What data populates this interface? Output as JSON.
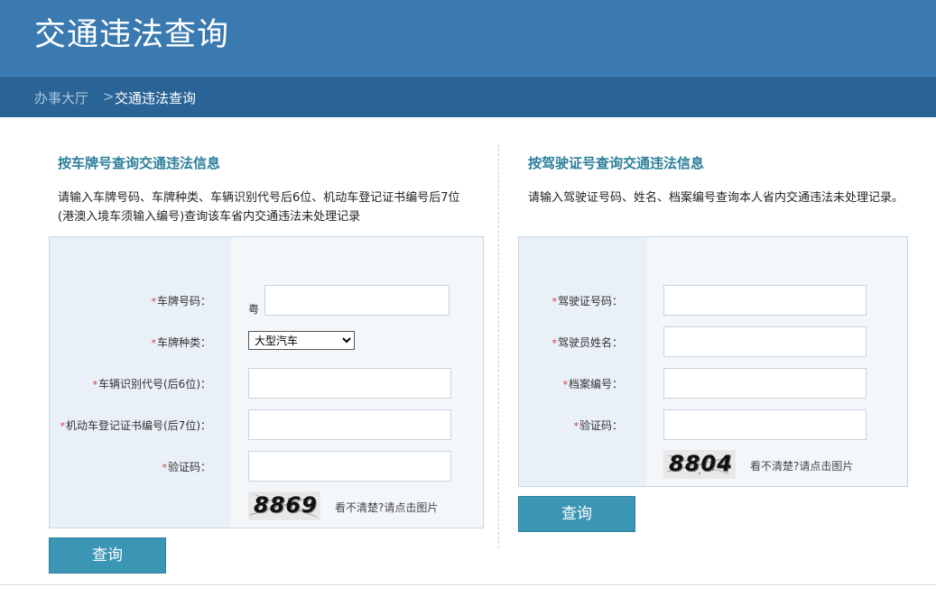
{
  "header": {
    "title": "交通违法查询"
  },
  "breadcrumb": {
    "home": "办事大厅",
    "separator": ">",
    "current": "交通违法查询"
  },
  "plate_query": {
    "title": "按车牌号查询交通违法信息",
    "description": "请输入车牌号码、车牌种类、车辆识别代号后6位、机动车登记证书编号后7位(港澳入境车须输入编号)查询该车省内交通违法未处理记录",
    "required_mark": "*",
    "fields": {
      "plate_number": {
        "label": "车牌号码：",
        "prefix": "粤",
        "value": ""
      },
      "plate_type": {
        "label": "车牌种类：",
        "selected": "大型汽车"
      },
      "vin": {
        "label": "车辆识别代号(后6位)：",
        "value": ""
      },
      "reg_cert": {
        "label": "机动车登记证书编号(后7位)：",
        "value": ""
      },
      "captcha": {
        "label": "验证码：",
        "value": ""
      }
    },
    "captcha_code": "8869",
    "captcha_tip": "看不清楚?请点击图片",
    "submit_label": "查询"
  },
  "license_query": {
    "title": "按驾驶证号查询交通违法信息",
    "description": "请输入驾驶证号码、姓名、档案编号查询本人省内交通违法未处理记录。",
    "required_mark": "*",
    "fields": {
      "license_number": {
        "label": "驾驶证号码：",
        "value": ""
      },
      "driver_name": {
        "label": "驾驶员姓名：",
        "value": ""
      },
      "archive_number": {
        "label": "档案编号：",
        "value": ""
      },
      "captcha": {
        "label": "验证码：",
        "value": ""
      }
    },
    "captcha_code": "8804",
    "captcha_tip": "看不清楚?请点击图片",
    "submit_label": "查询"
  },
  "colors": {
    "header_bg": "#3a7ab1",
    "breadcrumb_bg": "#2a6496",
    "section_title": "#2d7f9b",
    "button_bg": "#3b96b6",
    "required": "#d03a3a"
  }
}
